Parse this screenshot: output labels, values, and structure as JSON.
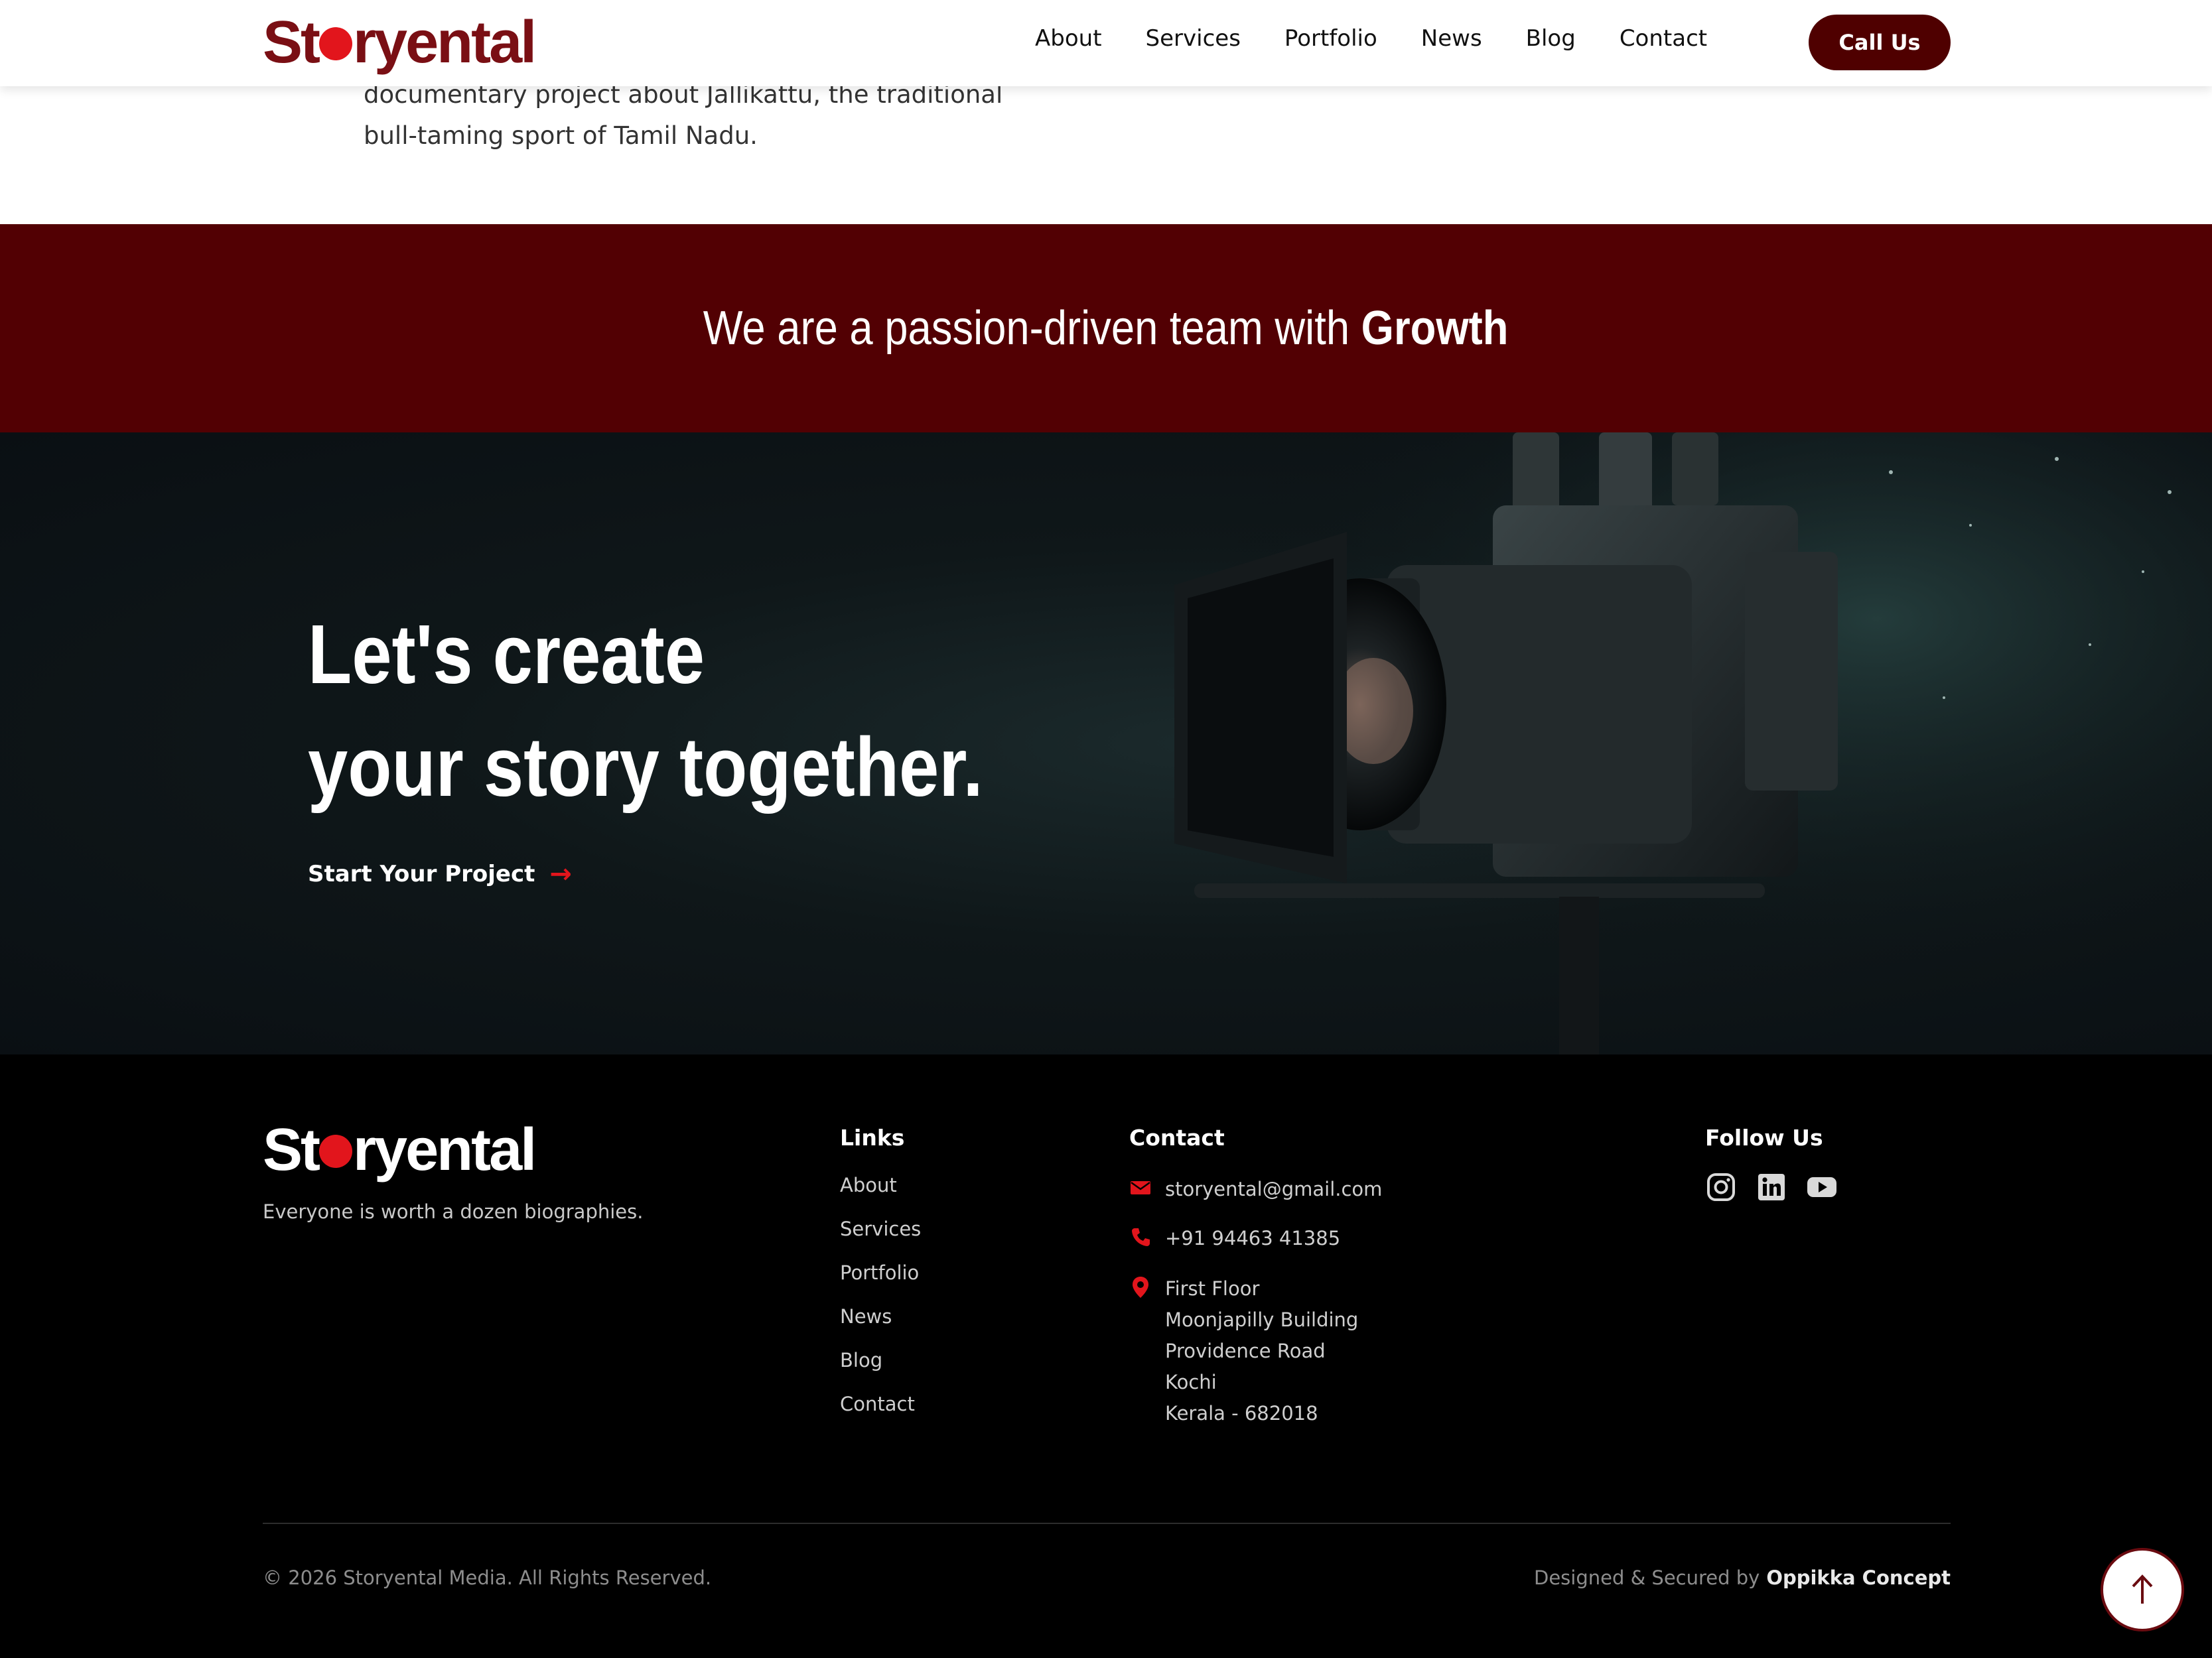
{
  "header": {
    "logo": "Storyental",
    "nav": [
      "About",
      "Services",
      "Portfolio",
      "News",
      "Blog",
      "Contact"
    ],
    "call_label": "Call Us"
  },
  "intro": {
    "lines": [
      "documentary project about Jallikattu, the traditional",
      "bull-taming sport of Tamil Nadu."
    ]
  },
  "banner": {
    "text": "We are a passion-driven team with ",
    "highlight": "Growth"
  },
  "cta": {
    "heading_line1": "Let's create",
    "heading_line2": "your story together.",
    "link_label": "Start Your Project"
  },
  "footer": {
    "logo": "Storyental",
    "tagline": "Everyone is worth a dozen biographies.",
    "links_title": "Links",
    "links": [
      "About",
      "Services",
      "Portfolio",
      "News",
      "Blog",
      "Contact"
    ],
    "contact_title": "Contact",
    "email": "storyental@gmail.com",
    "phone": "+91 94463 41385",
    "address": [
      "First Floor",
      "Moonjapilly Building",
      "Providence Road",
      "Kochi",
      "Kerala - 682018"
    ],
    "follow_title": "Follow Us",
    "social_icons": [
      "instagram-icon",
      "linkedin-icon",
      "youtube-icon"
    ],
    "copyright": "© 2026 Storyental Media. All Rights Reserved.",
    "designed_by_text": "Designed & Secured by",
    "designer": "Oppikka Concept"
  },
  "colors": {
    "brand_maroon": "#520003",
    "accent_red": "#e2151c",
    "button_maroon": "#4f0000",
    "footer_bg": "#000000"
  }
}
